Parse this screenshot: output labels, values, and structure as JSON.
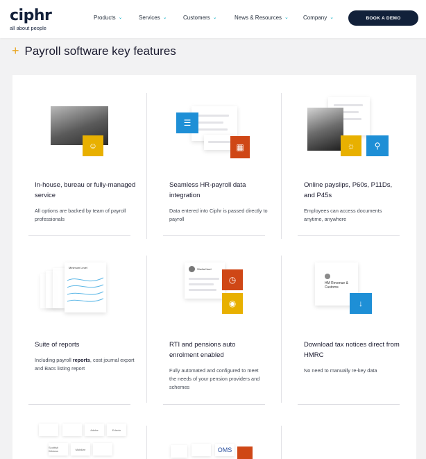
{
  "brand": {
    "name": "ciphr",
    "tagline": "all about people"
  },
  "nav": {
    "items": [
      "Products",
      "Services",
      "Customers",
      "News & Resources",
      "Company"
    ],
    "cta": "BOOK A DEMO"
  },
  "page": {
    "title": "Payroll software key features"
  },
  "features": [
    {
      "title": "In-house, bureau or fully-managed service",
      "desc": "All options are backed by team of payroll professionals"
    },
    {
      "title": "Seamless HR-payroll data integration",
      "desc": "Data entered into Ciphr is passed directly to payroll"
    },
    {
      "title": "Online payslips, P60s, P11Ds, and P45s",
      "desc": "Employees can access documents anytime, anywhere"
    },
    {
      "title": "Suite of reports",
      "desc_pre": "Including payroll ",
      "desc_bold": "reports",
      "desc_post": ", cost journal export and Bacs listing report"
    },
    {
      "title": "RTI and pensions auto enrolment enabled",
      "desc": "Fully automated and configured to meet the needs of your pension providers and schemes"
    },
    {
      "title": "Download tax notices direct from HMRC",
      "desc": "No need to manually re-key data"
    }
  ],
  "illustrations": {
    "reports_doc_title": "Minimum Level",
    "profile_name": "Sheila Noel",
    "hmrc_label": "HM Revenue & Customs",
    "partner_logos": [
      "Adobe",
      "Edexin",
      "Scottish Widows",
      "Mobilize",
      "OMS"
    ]
  },
  "colors": {
    "accent": "#e9a623",
    "brand_dark": "#12213a",
    "chevron": "#0fb0c8",
    "tile_blue": "#1e8fd6",
    "tile_orange": "#e8b000",
    "tile_red": "#cf4716"
  }
}
